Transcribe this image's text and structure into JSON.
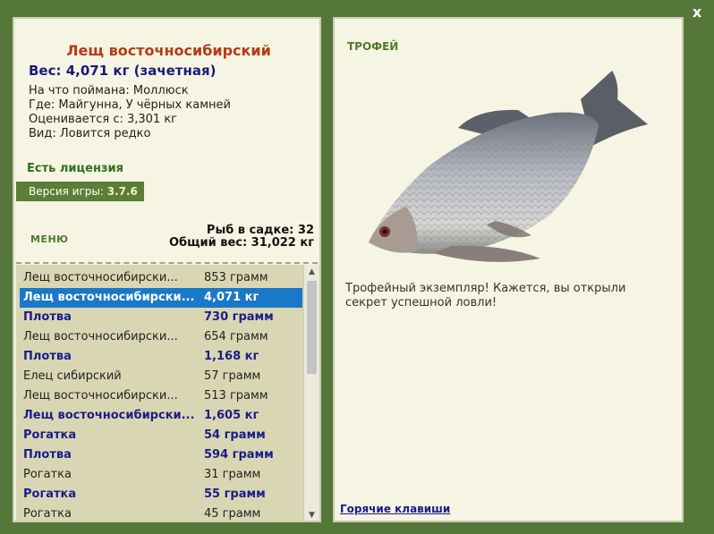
{
  "close_label": "x",
  "fish": {
    "title": "Лещ восточносибирский",
    "weight": "Вес: 4,071 кг (зачетная)",
    "bait": "На что поймана: Моллюск",
    "place": "Где: Майгунна, У чёрных камней",
    "rating": "Оценивается с: 3,301 кг",
    "kind": "Вид: Ловится редко"
  },
  "license": "Есть лицензия",
  "version": {
    "label": "Версия игры: ",
    "value": "3.7.6"
  },
  "menu_label": "МЕНЮ",
  "cage": {
    "count": "Рыб в садке: 32",
    "total": "Общий вес: 31,022 кг"
  },
  "list": [
    {
      "name": "Лещ восточносибирски...",
      "weight": "853 грамм",
      "style": "norm"
    },
    {
      "name": "Лещ восточносибирски...",
      "weight": "4,071 кг",
      "style": "sel"
    },
    {
      "name": "Плотва",
      "weight": "730 грамм",
      "style": "bold"
    },
    {
      "name": "Лещ восточносибирски...",
      "weight": "654 грамм",
      "style": "norm"
    },
    {
      "name": "Плотва",
      "weight": "1,168 кг",
      "style": "bold"
    },
    {
      "name": "Елец сибирский",
      "weight": "57 грамм",
      "style": "norm"
    },
    {
      "name": "Лещ восточносибирски...",
      "weight": "513 грамм",
      "style": "norm"
    },
    {
      "name": "Лещ восточносибирски...",
      "weight": "1,605 кг",
      "style": "bold"
    },
    {
      "name": "Рогатка",
      "weight": "54 грамм",
      "style": "bold"
    },
    {
      "name": "Плотва",
      "weight": "594 грамм",
      "style": "bold"
    },
    {
      "name": "Рогатка",
      "weight": "31 грамм",
      "style": "norm"
    },
    {
      "name": "Рогатка",
      "weight": "55 грамм",
      "style": "bold"
    },
    {
      "name": "Рогатка",
      "weight": "45 грамм",
      "style": "norm"
    }
  ],
  "trophy_label": "ТРОФЕЙ",
  "trophy_text": "Трофейный экземпляр! Кажется, вы открыли секрет успешной ловли!",
  "hotkeys": "Горячие клавиши"
}
